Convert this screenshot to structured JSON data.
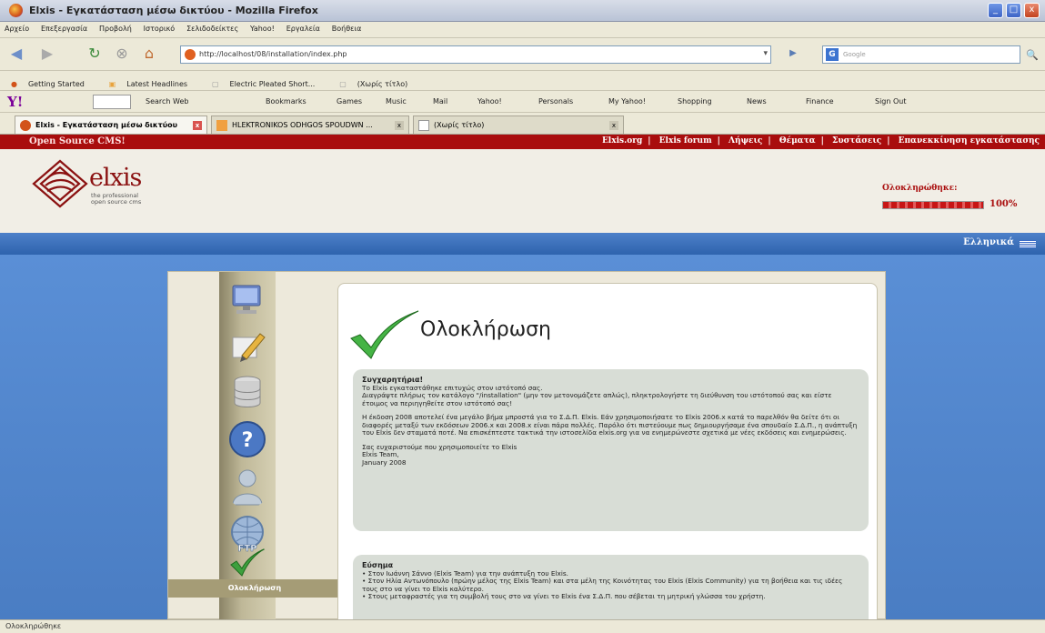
{
  "window": {
    "title": "Elxis - Εγκατάσταση μέσω δικτύου - Mozilla Firefox",
    "buttons": [
      "_",
      "□",
      "x"
    ]
  },
  "menubar": {
    "items": [
      "Αρχείο",
      "Επεξεργασία",
      "Προβολή",
      "Ιστορικό",
      "Σελιδοδείκτες",
      "Yahoo!",
      "Εργαλεία",
      "Βοήθεια"
    ]
  },
  "navbar": {
    "url": "http://localhost/08/installation/index.php",
    "search_placeholder": "Google"
  },
  "bookmarks": {
    "items": [
      "Getting Started",
      "Latest Headlines",
      "Electric Pleated Short...",
      "(Χωρίς τίτλο)"
    ]
  },
  "yahoo_toolbar": {
    "logo": "Y!",
    "items": [
      "Search Web",
      "Bookmarks",
      "Games",
      "Music",
      "Mail",
      "Yahoo!",
      "Personals",
      "My Yahoo!",
      "Shopping",
      "News",
      "Finance",
      "Sign Out"
    ]
  },
  "tabs": [
    {
      "label": "Elxis - Εγκατάσταση μέσω δικτύου",
      "active": true
    },
    {
      "label": "HLEKTRONIKOS ODHGOS SPOUDWN ...",
      "active": false
    },
    {
      "label": "(Χωρίς τίτλο)",
      "active": false
    }
  ],
  "site": {
    "brand": "Open Source CMS!",
    "top_links": [
      "Elxis.org",
      "Elxis forum",
      "Λήψεις",
      "Θέματα",
      "Συστάσεις",
      "Επανεκκίνηση εγκατάστασης"
    ],
    "logo_text": "elxis",
    "logo_sub1": "the professional",
    "logo_sub2": "open source cms",
    "progress_label": "Ολοκληρώθηκε:",
    "progress_value": "100%",
    "progress_fraction": 1.0,
    "language": "Ελληνικά"
  },
  "sidebar": {
    "current_step": "Ολοκλήρωση",
    "step_icons": [
      "monitor-icon",
      "pencil-icon",
      "database-icon",
      "help-icon",
      "user-icon",
      "ftp-icon",
      "check-icon"
    ],
    "ftp_text": "FTP"
  },
  "content": {
    "title": "Ολοκλήρωση",
    "congrats_heading": "Συγχαρητήρια!",
    "congrats_p1": "Το Elxis εγκαταστάθηκε επιτυχώς στον ιστότοπό σας.",
    "congrats_p2": "Διαγράψτε πλήρως τον κατάλογο \"/installation\" (μην τον μετονομάζετε απλώς), πληκτρολογήστε τη διεύθυνση του ιστότοπού σας και είστε έτοιμος να περιηγηθείτε στον ιστότοπό σας!",
    "congrats_p3": "Η έκδοση 2008 αποτελεί ένα μεγάλο βήμα μπροστά για το Σ.Δ.Π. Elxis. Εάν χρησιμοποιήσατε το Elxis 2006.x κατά το παρελθόν θα δείτε ότι οι διαφορές μεταξύ των εκδόσεων 2006.x και 2008.x είναι πάρα πολλές. Παρόλο ότι πιστεύουμε πως δημιουργήσαμε ένα σπουδαίο Σ.Δ.Π., η ανάπτυξη του Elxis δεν σταματά ποτέ. Να επισκέπτεστε τακτικά την ιστοσελίδα elxis.org για να ενημερώνεστε σχετικά με νέες εκδόσεις και ενημερώσεις.",
    "thanks": "Σας ευχαριστούμε που χρησιμοποιείτε το Elxis",
    "team": "Elxis Team,",
    "date": "January 2008",
    "credits_heading": "Εύσημα",
    "credits": [
      "• Στον Ιωάννη Σάννο (Elxis Team) για την ανάπτυξη του Elxis.",
      "• Στον Ηλία Αντωνόπουλο (πρώην μέλος της Elxis Team) και στα μέλη της Κοινότητας του Elxis (Elxis Community) για τη βοήθεια και τις ιδέες τους στο να γίνει το Elxis καλύτερο.",
      "• Στους μεταφραστές για τη συμβολή τους στο να γίνει το Elxis ένα Σ.Δ.Π. που σέβεται τη μητρική γλώσσα του χρήστη."
    ]
  },
  "statusbar": {
    "text": "Ολοκληρώθηκε"
  }
}
